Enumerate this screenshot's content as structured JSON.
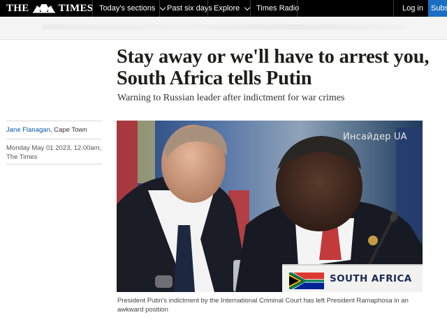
{
  "nav": {
    "logo_left": "THE",
    "logo_right": "TIMES",
    "items": [
      {
        "label": "Today's sections",
        "dropdown": true
      },
      {
        "label": "Past six days",
        "dropdown": false
      },
      {
        "label": "Explore",
        "dropdown": true
      },
      {
        "label": "Times Radio",
        "dropdown": false
      }
    ],
    "login": "Log in",
    "subscribe": "Subscribe"
  },
  "article": {
    "headline": "Stay away or we'll have to arrest you, South Africa tells Putin",
    "standfirst": "Warning to Russian leader after indictment for war crimes",
    "author": "Jane Flanagan",
    "location": ", Cape Town",
    "date": "Monday May 01 2023, 12.00am,",
    "publication": "The Times",
    "photo": {
      "watermark": "Инсайдер UA",
      "placard": "SOUTH AFRICA"
    },
    "caption": "President Putin's indictment by the International Criminal Court has left President Ramaphosa in an awkward position"
  },
  "colors": {
    "nav_bg": "#000000",
    "subscribe_bg": "#1c6ec3",
    "byline_link": "#0a5aa6"
  }
}
